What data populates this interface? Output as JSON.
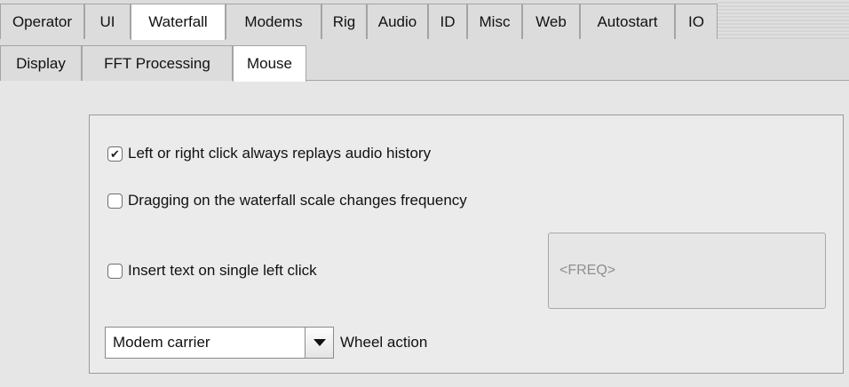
{
  "tabs_top": [
    {
      "label": "Operator",
      "active": false
    },
    {
      "label": "UI",
      "active": false
    },
    {
      "label": "Waterfall",
      "active": true
    },
    {
      "label": "Modems",
      "active": false
    },
    {
      "label": "Rig",
      "active": false
    },
    {
      "label": "Audio",
      "active": false
    },
    {
      "label": "ID",
      "active": false
    },
    {
      "label": "Misc",
      "active": false
    },
    {
      "label": "Web",
      "active": false
    },
    {
      "label": "Autostart",
      "active": false
    },
    {
      "label": "IO",
      "active": false
    }
  ],
  "tabs_sub": [
    {
      "label": "Display",
      "active": false
    },
    {
      "label": "FFT Processing",
      "active": false
    },
    {
      "label": "Mouse",
      "active": true
    }
  ],
  "mouse": {
    "replay_history": {
      "label": "Left or right click always replays audio history",
      "checked": true
    },
    "drag_scale": {
      "label": "Dragging on the waterfall scale changes frequency",
      "checked": false
    },
    "insert_text": {
      "label": "Insert text on single left click",
      "checked": false
    },
    "insert_text_value": "<FREQ>",
    "wheel_action": {
      "selected": "Modem carrier",
      "label": "Wheel action"
    }
  },
  "icons": {
    "check": "check-icon",
    "dropdown": "triangle-down-icon"
  }
}
